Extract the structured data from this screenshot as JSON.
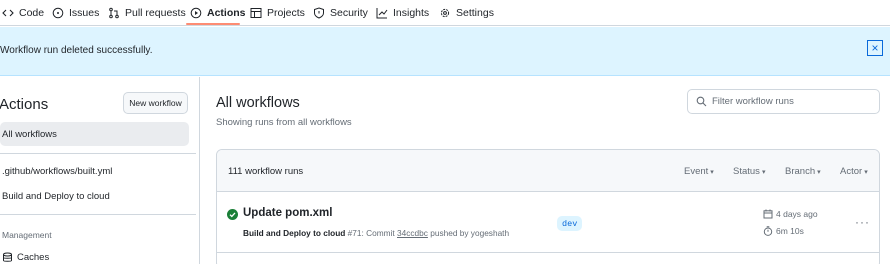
{
  "nav": {
    "items": [
      {
        "label": "Code",
        "icon": "code-icon"
      },
      {
        "label": "Issues",
        "icon": "issue-circle-icon"
      },
      {
        "label": "Pull requests",
        "icon": "git-pull-request-icon"
      },
      {
        "label": "Actions",
        "icon": "play-icon",
        "active": true
      },
      {
        "label": "Projects",
        "icon": "table-icon"
      },
      {
        "label": "Security",
        "icon": "shield-icon"
      },
      {
        "label": "Insights",
        "icon": "graph-icon"
      },
      {
        "label": "Settings",
        "icon": "gear-icon"
      }
    ]
  },
  "flash": {
    "message": "Workflow run deleted successfully.",
    "close_symbol": "×"
  },
  "sidebar": {
    "title": "Actions",
    "new_workflow_label": "New workflow",
    "items": [
      {
        "label": "All workflows",
        "active": true
      },
      {
        "label": ".github/workflows/built.yml"
      },
      {
        "label": "Build and Deploy to cloud"
      }
    ],
    "management_heading": "Management",
    "caches_label": "Caches"
  },
  "main": {
    "title": "All workflows",
    "subtitle": "Showing runs from all workflows",
    "filter_placeholder": "Filter workflow runs",
    "runs_count": "111 workflow runs",
    "filters": {
      "event": "Event",
      "status": "Status",
      "branch": "Branch",
      "actor": "Actor"
    },
    "runs": [
      {
        "title": "Update pom.xml",
        "workflow": "Build and Deploy to cloud",
        "number": "#71",
        "commit_prefix": ": Commit",
        "sha": "34ccdbc",
        "pushed_by": "pushed by yogeshath",
        "branch": "dev",
        "time_ago": "4 days ago",
        "duration": "6m 10s",
        "status": "success"
      }
    ]
  },
  "colors": {
    "accent_underline": "#fd8c73",
    "flash_bg": "#ddf4ff",
    "success": "#1a7f37",
    "link": "#0969da"
  }
}
